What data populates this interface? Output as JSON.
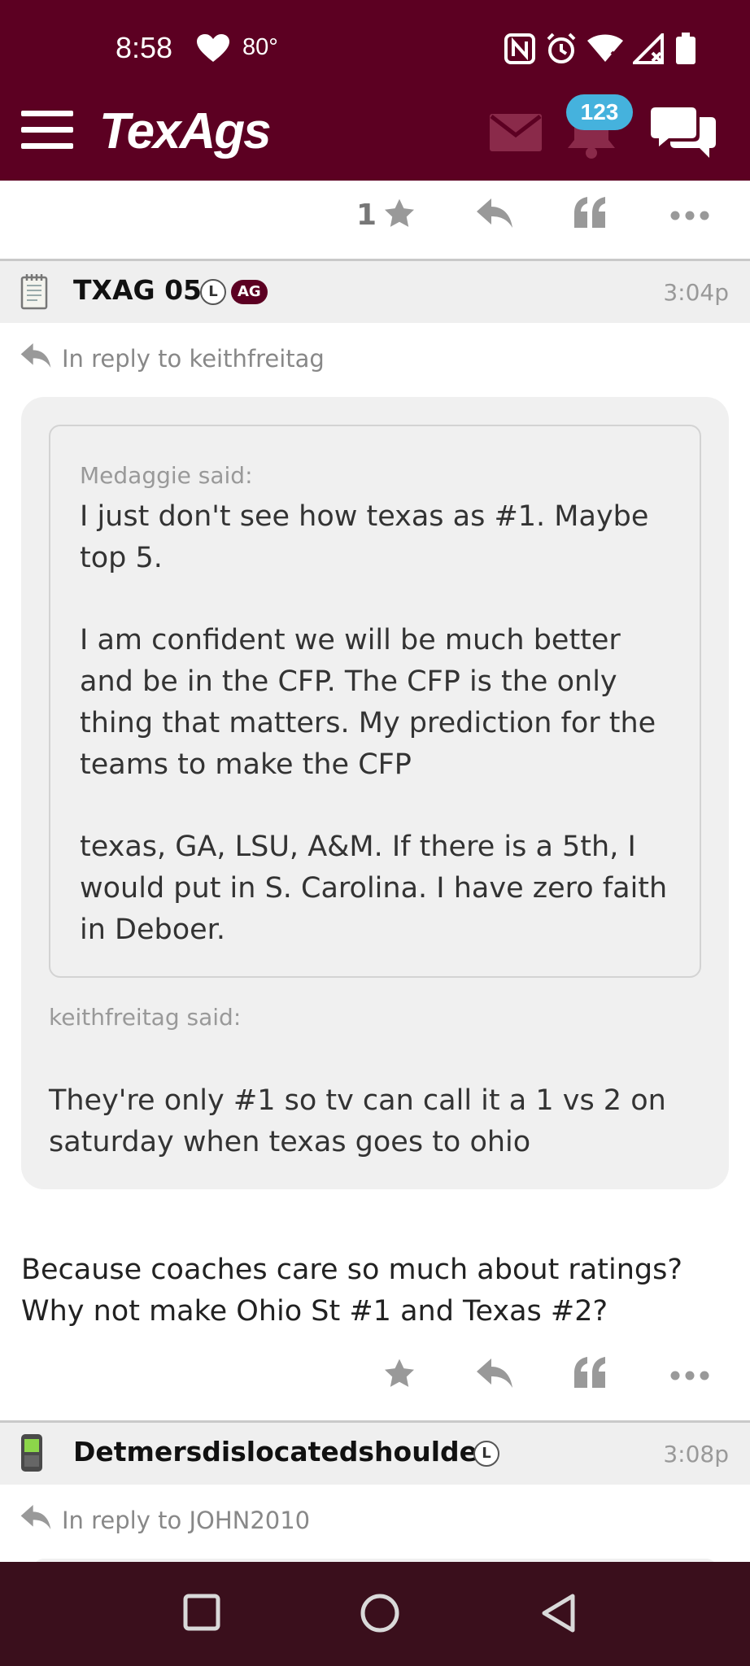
{
  "status_bar": {
    "time": "8:58",
    "temperature": "80°"
  },
  "header": {
    "logo": "TexAgs",
    "notification_count": "123"
  },
  "first_action_row": {
    "star_count": "1"
  },
  "post": {
    "username": "TXAG 05",
    "tag_l": "L",
    "tag_ag": "AG",
    "time": "3:04p",
    "reply_to": "In reply to keithfreitag",
    "nested_quote": {
      "author": "Medaggie said:",
      "paragraphs": [
        "I just don't see how texas as #1. Maybe top 5.",
        "I am confident we will be much better and be in the CFP. The CFP is the only thing that matters. My prediction for the teams to make the CFP",
        "texas, GA, LSU, A&M. If there is a 5th, I would put in S. Carolina. I have zero faith in Deboer."
      ]
    },
    "quote": {
      "author": "keithfreitag said:",
      "text": "They're only #1 so tv can call it a 1 vs 2 on saturday when texas goes to ohio"
    },
    "body": "Because coaches care so much about ratings? Why not make Ohio St #1 and Texas #2?"
  },
  "next_post": {
    "username": "Detmersdislocatedshoulder",
    "tag_l": "L",
    "time": "3:08p",
    "reply_to": "In reply to JOHN2010"
  },
  "colors": {
    "brand": "#5c0022",
    "badge": "#45b2dd",
    "navbar": "#3a0f1c"
  }
}
